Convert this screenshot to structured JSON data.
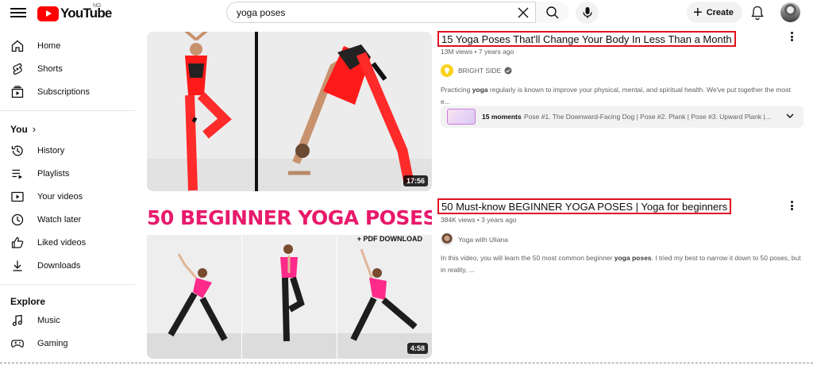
{
  "header": {
    "logo_text": "YouTube",
    "country_code": "NG",
    "search_value": "yoga poses",
    "create_label": "Create",
    "icons": [
      "menu-icon",
      "youtube-logo-icon",
      "clear-icon",
      "search-icon",
      "mic-icon",
      "plus-icon",
      "bell-icon",
      "avatar"
    ]
  },
  "sidebar": {
    "main": [
      {
        "label": "Home",
        "icon": "home-icon"
      },
      {
        "label": "Shorts",
        "icon": "shorts-icon"
      },
      {
        "label": "Subscriptions",
        "icon": "subscriptions-icon"
      }
    ],
    "you_title": "You",
    "you_items": [
      {
        "label": "History",
        "icon": "history-icon"
      },
      {
        "label": "Playlists",
        "icon": "playlists-icon"
      },
      {
        "label": "Your videos",
        "icon": "your-videos-icon"
      },
      {
        "label": "Watch later",
        "icon": "watch-later-icon"
      },
      {
        "label": "Liked videos",
        "icon": "liked-videos-icon"
      },
      {
        "label": "Downloads",
        "icon": "downloads-icon"
      }
    ],
    "explore_title": "Explore",
    "explore_items": [
      {
        "label": "Music",
        "icon": "music-icon"
      },
      {
        "label": "Gaming",
        "icon": "gaming-icon"
      }
    ]
  },
  "results": [
    {
      "title": "15 Yoga Poses That'll Change Your Body In Less Than a Month",
      "views": "13M views",
      "age": "7 years ago",
      "channel": "BRIGHT SIDE",
      "verified": true,
      "description_prefix": "Practicing ",
      "description_bold": "yoga",
      "description_suffix": " regularly is known to improve your physical, mental, and spiritual health. We've put together the most e...",
      "moments_count": "15 moments",
      "moments_text": "Pose #1. The Downward-Facing Dog | Pose #2. Plank | Pose #3. Upward Plank |...",
      "duration": "17:56"
    },
    {
      "title": "50 Must-know BEGINNER YOGA POSES | Yoga for beginners",
      "views": "384K views",
      "age": "3 years ago",
      "channel": "Yoga with Uliana",
      "description_prefix": "In this video, you will learn the 50 most common beginner ",
      "description_bold": "yoga poses",
      "description_suffix": ". I tried my best to narrow it down to 50 poses, but in reality, ...",
      "thumb_headline": "50 BEGINNER YOGA POSES",
      "thumb_badge": "+ PDF DOWNLOAD",
      "duration": "4:58"
    }
  ],
  "colors": {
    "brand_red": "#ff0000",
    "highlight_red": "#e0101e",
    "thumb_headline_pink": "#e8196b",
    "text_primary": "#0f0f0f",
    "text_secondary": "#606060"
  }
}
